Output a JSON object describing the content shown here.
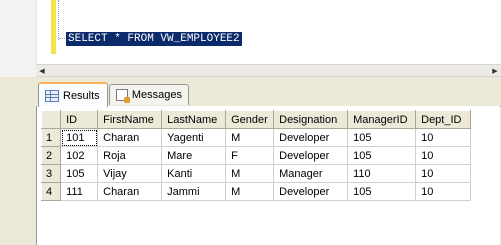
{
  "editor": {
    "query": "SELECT * FROM VW_EMPLOYEE2"
  },
  "results_pane": {
    "tabs": [
      {
        "label": "Results",
        "icon": "grid-icon",
        "active": true
      },
      {
        "label": "Messages",
        "icon": "messages-icon",
        "active": false
      }
    ],
    "columns": [
      "ID",
      "FirstName",
      "LastName",
      "Gender",
      "Designation",
      "ManagerID",
      "Dept_ID"
    ],
    "rows": [
      {
        "num": "1",
        "cells": [
          "101",
          "Charan",
          "Yagenti",
          "M",
          "Developer",
          "105",
          "10"
        ]
      },
      {
        "num": "2",
        "cells": [
          "102",
          "Roja",
          "Mare",
          "F",
          "Developer",
          "105",
          "10"
        ]
      },
      {
        "num": "3",
        "cells": [
          "105",
          "Vijay",
          "Kanti",
          "M",
          "Manager",
          "110",
          "10"
        ]
      },
      {
        "num": "4",
        "cells": [
          "111",
          "Charan",
          "Jammi",
          "M",
          "Developer",
          "105",
          "10"
        ]
      }
    ]
  },
  "colors": {
    "selection": "#0b2a6b",
    "change_bar": "#f5e24a",
    "active_tab_accent": "#f7b45a",
    "chrome": "#ece9d8"
  }
}
